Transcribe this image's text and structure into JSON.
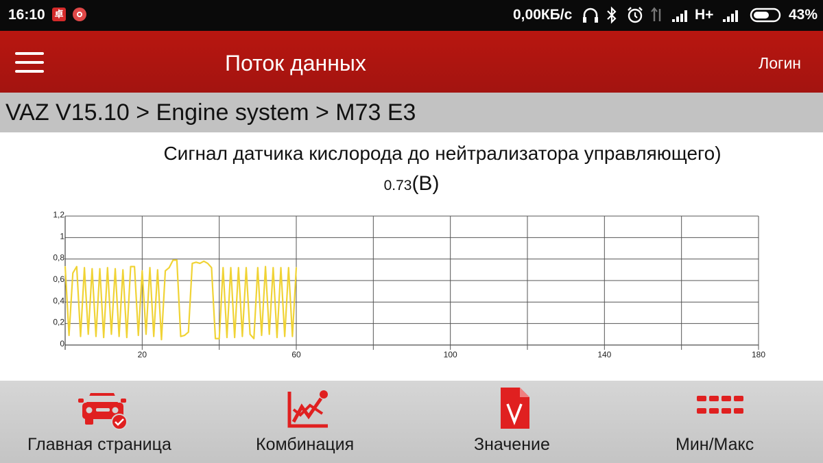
{
  "status_bar": {
    "time": "16:10",
    "app_icon_1_text": "卓",
    "net_speed": "0,00КБ/с",
    "network_type": "H+",
    "battery_pct": "43%"
  },
  "app_bar": {
    "title": "Поток данных",
    "login_label": "Логин"
  },
  "breadcrumb": "VAZ V15.10 > Engine system > M73 E3",
  "parameter": {
    "name": "Сигнал датчика кислорода до нейтрализатора управляющего)",
    "value": "0.73",
    "unit": "(В)"
  },
  "chart_data": {
    "type": "line",
    "series": [
      {
        "values": [
          0.73,
          0.09,
          0.67,
          0.73,
          0.08,
          0.72,
          0.1,
          0.71,
          0.08,
          0.71,
          0.07,
          0.72,
          0.1,
          0.71,
          0.08,
          0.7,
          0.07,
          0.73,
          0.73,
          0.09,
          0.69,
          0.1,
          0.72,
          0.08,
          0.7,
          0.05,
          0.69,
          0.72,
          0.79,
          0.79,
          0.08,
          0.09,
          0.12,
          0.76,
          0.77,
          0.76,
          0.78,
          0.76,
          0.72,
          0.06,
          0.06,
          0.72,
          0.07,
          0.72,
          0.07,
          0.72,
          0.08,
          0.72,
          0.1,
          0.06,
          0.72,
          0.09,
          0.73,
          0.1,
          0.72,
          0.07,
          0.72,
          0.08,
          0.72,
          0.08,
          0.72
        ]
      }
    ],
    "xlim": [
      0,
      180
    ],
    "ylim": [
      0,
      1.2
    ],
    "x_ticks": [
      "20",
      "60",
      "100",
      "140",
      "180"
    ],
    "y_ticks": [
      "0",
      "0,2",
      "0,4",
      "0,6",
      "0,8",
      "1",
      "1,2"
    ],
    "series_color": "#f0d335",
    "grid": true
  },
  "bottom_nav": [
    {
      "label": "Главная страница",
      "icon": "car-icon"
    },
    {
      "label": "Комбинация",
      "icon": "chart-icon"
    },
    {
      "label": "Значение",
      "icon": "document-icon"
    },
    {
      "label": "Мин/Макс",
      "icon": "grid-icon"
    }
  ],
  "colors": {
    "accent": "#b81610",
    "icon_red": "#e02020"
  }
}
